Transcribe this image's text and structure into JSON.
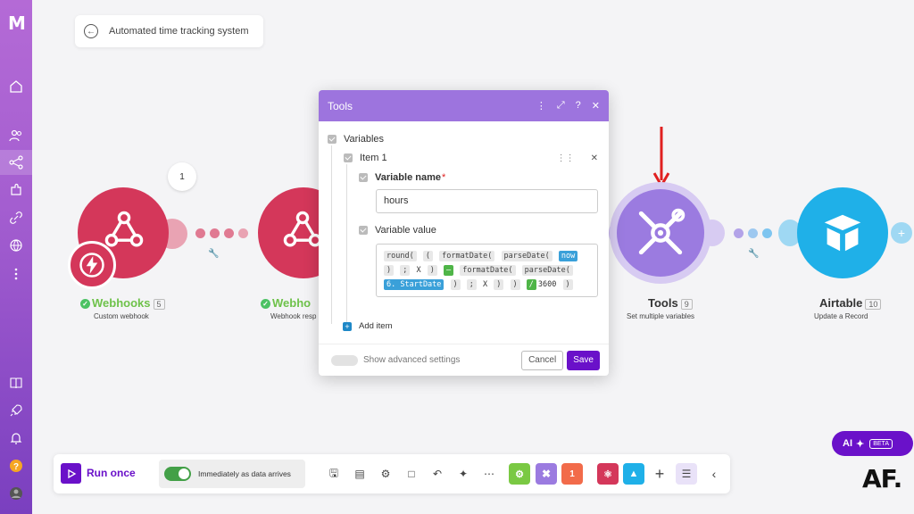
{
  "sidebar": {
    "logo": "M"
  },
  "scenario": {
    "title": "Automated time tracking system"
  },
  "nodes": {
    "webhooks": {
      "title": "Webhooks",
      "num": "5",
      "subtitle": "Custom webhook",
      "bubble": "1"
    },
    "webhook_response": {
      "title": "Webho",
      "subtitle": "Webhook resp"
    },
    "tools": {
      "title": "Tools",
      "num": "9",
      "subtitle": "Set multiple variables"
    },
    "airtable": {
      "title": "Airtable",
      "num": "10",
      "subtitle": "Update a Record"
    }
  },
  "modal": {
    "title": "Tools",
    "variables_label": "Variables",
    "item_label": "Item 1",
    "var_name_label": "Variable name",
    "required_mark": "*",
    "var_name_value": "hours",
    "var_value_label": "Variable value",
    "expression": {
      "line1": [
        "round(",
        "(",
        "formatDate(",
        "parseDate(",
        "now"
      ],
      "line2": [
        ")",
        ";",
        "X",
        ")",
        "–",
        "formatDate(",
        "parseDate("
      ],
      "line3": [
        "6. StartDate",
        ")",
        ";",
        "X",
        ")",
        ")",
        "/",
        "3600",
        ")"
      ]
    },
    "add_item_label": "Add item",
    "advanced_label": "Show advanced settings",
    "cancel_label": "Cancel",
    "save_label": "Save"
  },
  "toolbar": {
    "run_label": "Run once",
    "schedule_label": "Immediately as data arrives",
    "tile_labels": [
      "",
      "",
      "1"
    ]
  },
  "ai": {
    "label": "AI",
    "badge": "BETA"
  },
  "watermark": "AF.",
  "colors": {
    "accent": "#6a11c9",
    "webhook": "#d4375a",
    "tools": "#9b7be0",
    "airtable": "#1fb0e8"
  }
}
